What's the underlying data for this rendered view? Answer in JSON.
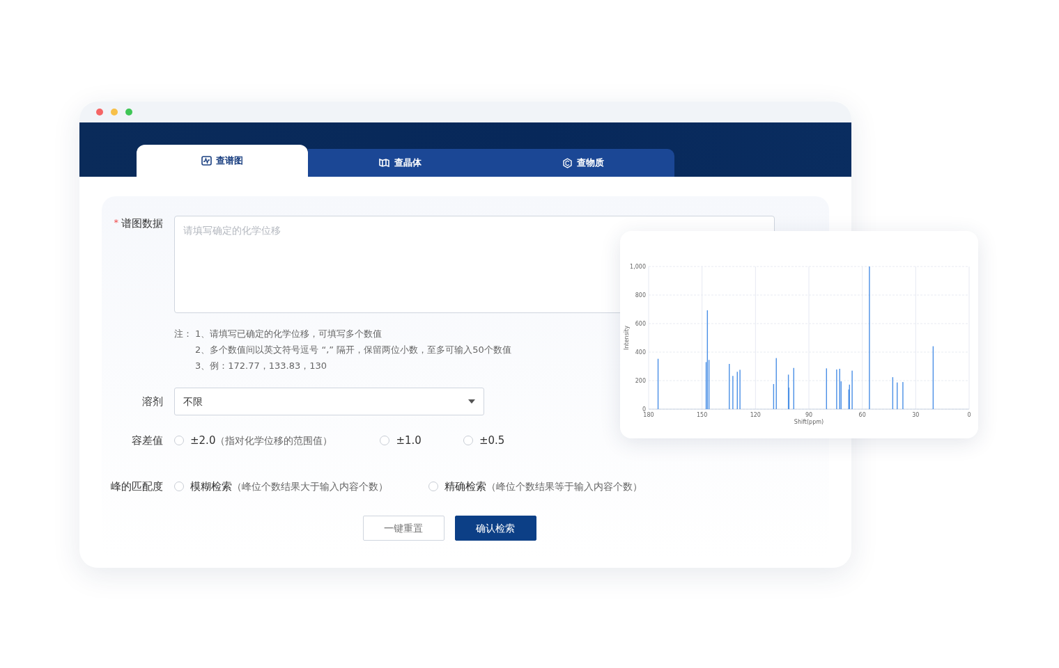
{
  "tabs": [
    {
      "label": "查谱图",
      "selected": true
    },
    {
      "label": "查晶体",
      "selected": false
    },
    {
      "label": "查物质",
      "selected": false
    }
  ],
  "form": {
    "spectrum": {
      "label": "谱图数据",
      "required_mark": "*",
      "placeholder": "请填写确定的化学位移",
      "notes_prefix": "注：",
      "notes": [
        "1、请填写已确定的化学位移，可填写多个数值",
        "2、多个数值间以英文符号逗号 “,” 隔开，保留两位小数，至多可输入50个数值",
        "3、例：172.77，133.83，130"
      ]
    },
    "solvent": {
      "label": "溶剂",
      "value": "不限"
    },
    "tolerance": {
      "label": "容差值",
      "options": [
        {
          "label": "±2.0",
          "hint": "（指对化学位移的范围值）",
          "selected": false
        },
        {
          "label": "±1.0",
          "selected": false
        },
        {
          "label": "±0.5",
          "selected": false
        }
      ]
    },
    "match": {
      "label": "峰的匹配度",
      "options": [
        {
          "label": "模糊检索",
          "hint": "（峰位个数结果大于输入内容个数）",
          "selected": false
        },
        {
          "label": "精确检索",
          "hint": "（峰位个数结果等于输入内容个数）",
          "selected": false
        }
      ]
    },
    "buttons": [
      {
        "label": "一键重置",
        "kind": "secondary"
      },
      {
        "label": "确认检索",
        "kind": "primary"
      }
    ]
  },
  "spectrum_card": {
    "chart_data": {
      "type": "bar",
      "grid": true,
      "xlabel": "Shift(ppm)",
      "ylabel": "Intensity",
      "x": [
        174.7,
        147.7,
        147.0,
        146.1,
        134.7,
        132.7,
        130.2,
        128.7,
        109.8,
        108.3,
        101.5,
        101.2,
        98.5,
        80.1,
        74.4,
        72.7,
        71.9,
        67.6,
        67.2,
        65.7,
        56.0,
        42.9,
        40.4,
        37.2,
        20.2
      ],
      "values": [
        353,
        330,
        693,
        345,
        317,
        233,
        262,
        276,
        176,
        358,
        242,
        151,
        289,
        286,
        278,
        283,
        195,
        138,
        172,
        270,
        1000,
        224,
        187,
        190,
        441
      ],
      "xlim": [
        180,
        0
      ],
      "ylim": [
        0,
        1000
      ],
      "xticks": [
        180,
        150,
        120,
        90,
        60,
        30,
        0
      ],
      "yticks": [
        0,
        200,
        400,
        600,
        800,
        {
          "value": 1000,
          "label": "1,000"
        }
      ]
    }
  }
}
